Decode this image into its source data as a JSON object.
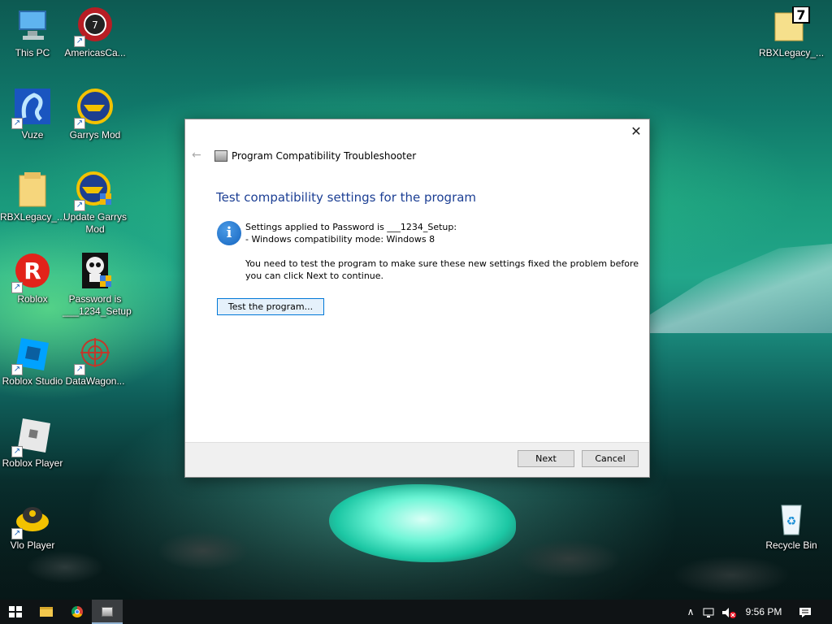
{
  "desktop": {
    "icons_left": [
      {
        "label": "This PC",
        "icon": "computer-icon"
      },
      {
        "label": "AmericasCa...",
        "icon": "casino-chip-icon"
      },
      {
        "label": "Vuze",
        "icon": "frog-icon"
      },
      {
        "label": "Garrys Mod",
        "icon": "garrys-mod-icon"
      },
      {
        "label": "RBXLegacy_...",
        "icon": "folder-icon"
      },
      {
        "label": "Update Garrys Mod",
        "icon": "garrys-mod-update-icon"
      },
      {
        "label": "Roblox",
        "icon": "roblox-icon"
      },
      {
        "label": "Password is ___1234_Setup",
        "icon": "skull-setup-icon"
      },
      {
        "label": "Roblox Studio",
        "icon": "roblox-studio-icon"
      },
      {
        "label": "DataWagon...",
        "icon": "datawagon-icon"
      },
      {
        "label": "Roblox Player",
        "icon": "roblox-player-icon"
      },
      {
        "label": "Vlo Player",
        "icon": "vlo-player-icon"
      }
    ],
    "icons_right": [
      {
        "label": "RBXLegacy_...",
        "icon": "folder-7-icon"
      },
      {
        "label": "Recycle Bin",
        "icon": "recycle-bin-icon"
      }
    ]
  },
  "dialog": {
    "wizard_title": "Program Compatibility Troubleshooter",
    "heading": "Test compatibility settings for the program",
    "settings_line1": "Settings applied to Password is ___1234_Setup:",
    "settings_line2": "- Windows compatibility mode: Windows 8",
    "instruction_line1": "You need to test the program to make sure these new settings fixed the problem before",
    "instruction_line2": "you can click Next to continue.",
    "test_button": "Test the program...",
    "next_button": "Next",
    "cancel_button": "Cancel",
    "close_glyph": "✕",
    "back_glyph": "←",
    "info_glyph": "i"
  },
  "taskbar": {
    "clock": "9:56 PM",
    "tray_up_glyph": "∧",
    "notification_glyph": "▭"
  }
}
